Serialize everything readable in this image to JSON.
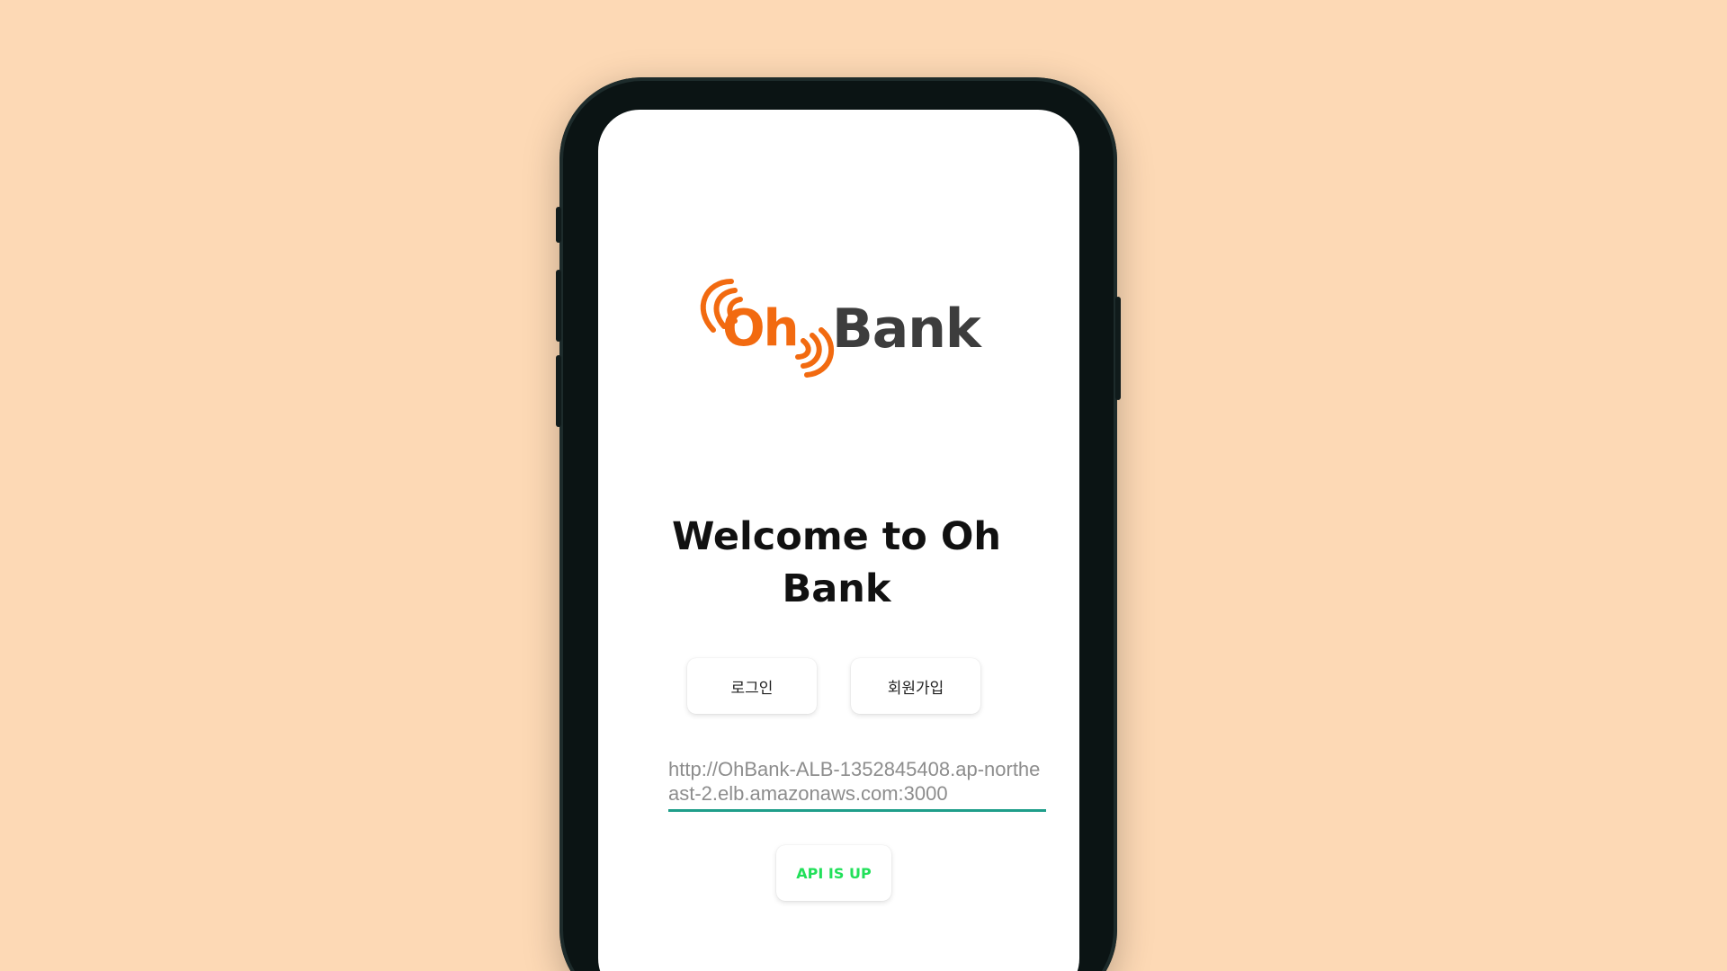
{
  "logo": {
    "oh_text": "Oh",
    "bank_text": "Bank"
  },
  "welcome": {
    "line1": "Welcome to Oh",
    "line2": "Bank"
  },
  "buttons": {
    "login_label": "로그인",
    "signup_label": "회원가입",
    "api_status_label": "API IS UP"
  },
  "api_url_field": {
    "value": "http://OhBank-ALB-1352845408.ap-northeast-2.elb.amazonaws.com:3000"
  },
  "colors": {
    "background": "#fdd9b5",
    "brand_orange": "#f26a10",
    "brand_gray": "#3d3d3d",
    "field_underline": "#1f9e8a",
    "api_status_green": "#22e05a"
  }
}
